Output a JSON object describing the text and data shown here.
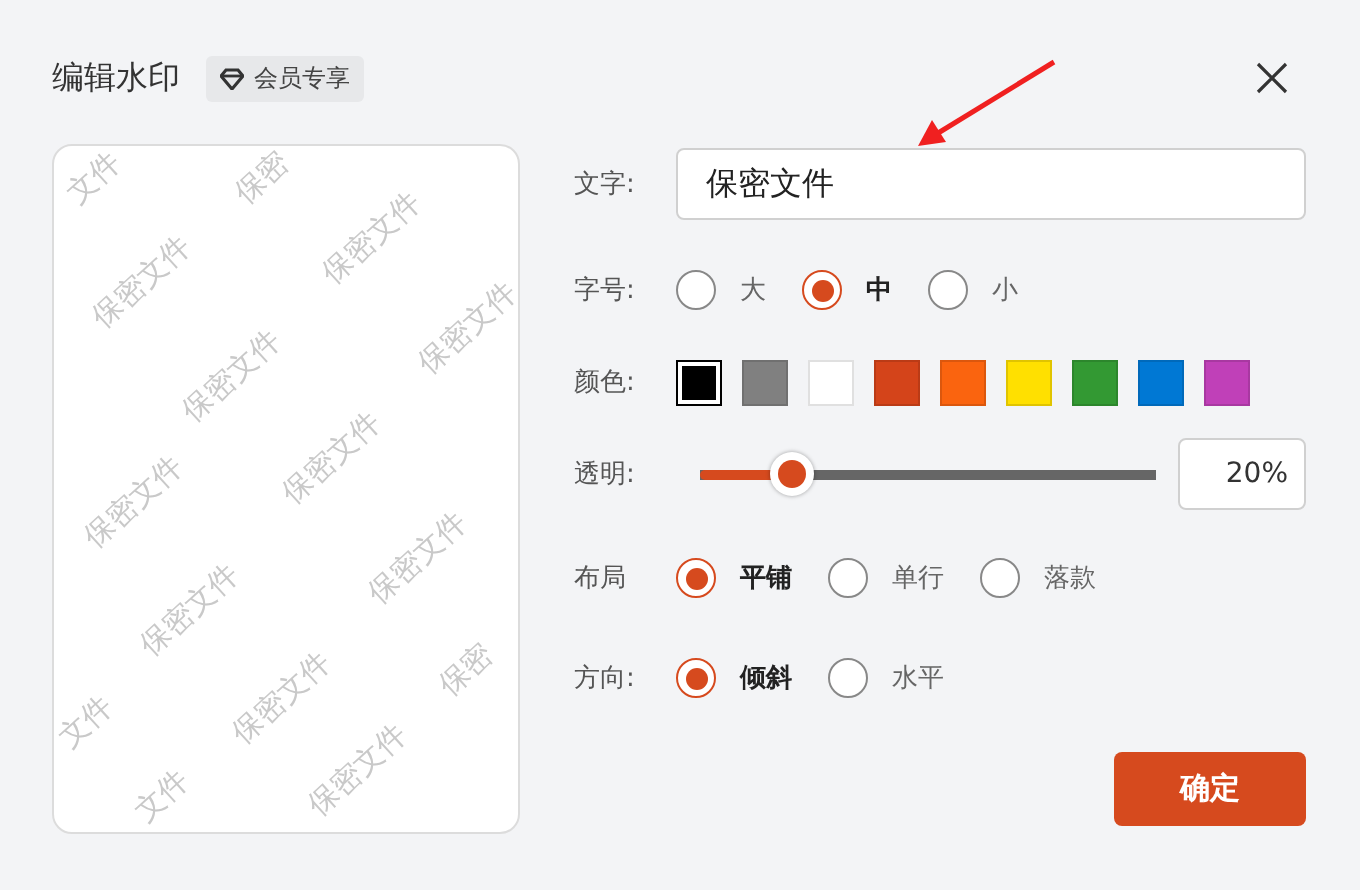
{
  "dialog": {
    "title": "编辑水印",
    "badge": "会员专享"
  },
  "preview": {
    "tiles": [
      "文件",
      "保密",
      "保密文件",
      "保密文件",
      "保密文件",
      "保密文件",
      "保密文件",
      "保密文件",
      "保密文件",
      "保密文件",
      "保密文件",
      "保密文件",
      "保密",
      "文件",
      "文件"
    ]
  },
  "text_field": {
    "label": "文字:",
    "value": "保密文件"
  },
  "font_size": {
    "label": "字号:",
    "options": [
      {
        "label": "大",
        "selected": false
      },
      {
        "label": "中",
        "selected": true
      },
      {
        "label": "小",
        "selected": false
      }
    ]
  },
  "color": {
    "label": "颜色:",
    "swatches": [
      {
        "color": "#000000",
        "selected": true
      },
      {
        "color": "#808080",
        "selected": false
      },
      {
        "color": "#ffffff",
        "selected": false
      },
      {
        "color": "#d4441a",
        "selected": false
      },
      {
        "color": "#fa640f",
        "selected": false
      },
      {
        "color": "#ffe000",
        "selected": false
      },
      {
        "color": "#339933",
        "selected": false
      },
      {
        "color": "#0078d4",
        "selected": false
      },
      {
        "color": "#c040b8",
        "selected": false
      }
    ]
  },
  "opacity": {
    "label": "透明:",
    "level": 0.2,
    "reading": "20%"
  },
  "layout": {
    "label": "布局",
    "options": [
      {
        "label": "平铺",
        "selected": true
      },
      {
        "label": "单行",
        "selected": false
      },
      {
        "label": "落款",
        "selected": false
      }
    ]
  },
  "direction": {
    "label": "方向:",
    "options": [
      {
        "label": "倾斜",
        "selected": true
      },
      {
        "label": "水平",
        "selected": false
      }
    ]
  },
  "confirm_button": "确定"
}
